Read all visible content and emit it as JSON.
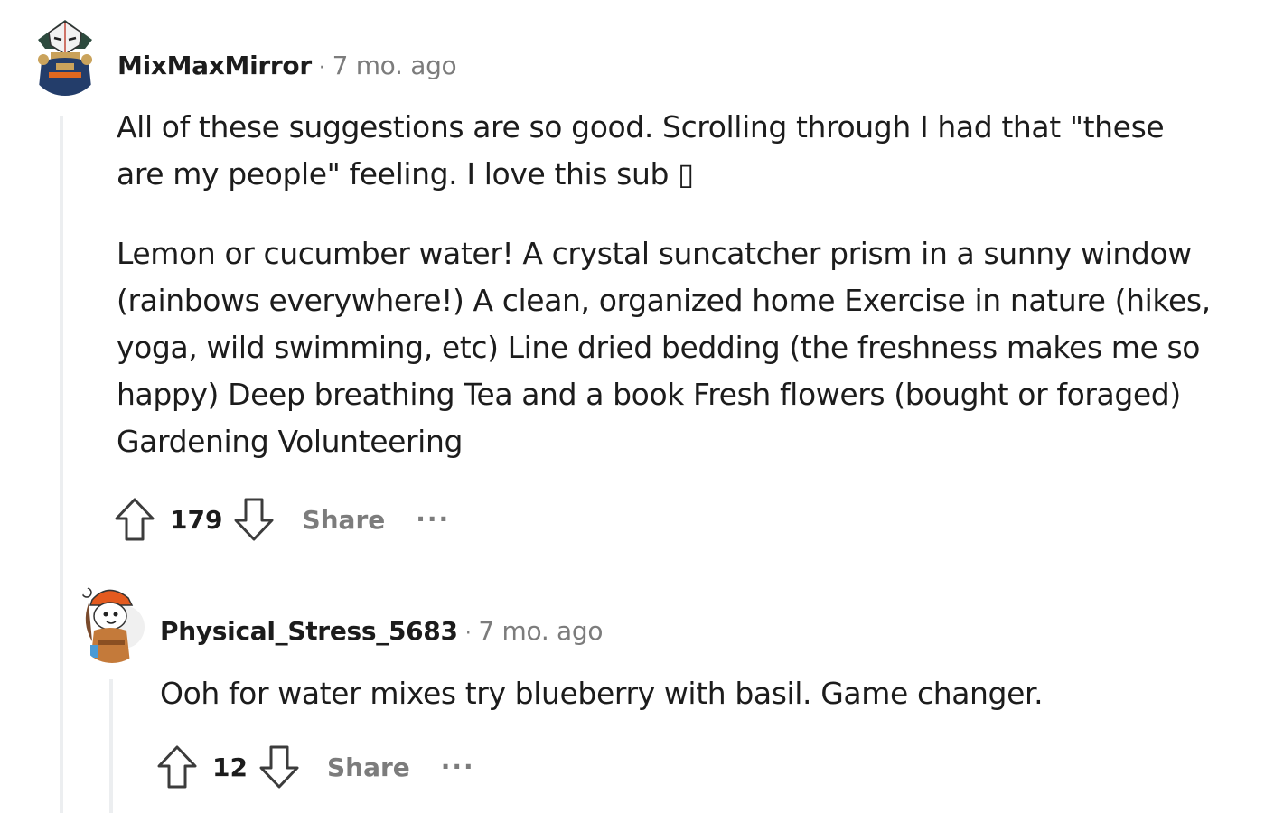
{
  "comments": [
    {
      "username": "MixMaxMirror",
      "separator": "·",
      "time": "7 mo. ago",
      "paragraphs": [
        "All of these suggestions are so good. Scrolling through I had that \"these are my people\" feeling. I love this sub ▯",
        "Lemon or cucumber water! A crystal suncatcher prism in a sunny window (rainbows everywhere!) A clean, organized home Exercise in nature (hikes, yoga, wild swimming, etc) Line dried bedding (the freshness makes me so happy) Deep breathing Tea and a book Fresh flowers (bought or foraged) Gardening Volunteering"
      ],
      "score": "179",
      "share_label": "Share",
      "more_label": "..."
    },
    {
      "username": "Physical_Stress_5683",
      "separator": "·",
      "time": "7 mo. ago",
      "paragraphs": [
        "Ooh for water mixes try blueberry with basil. Game changer."
      ],
      "score": "12",
      "share_label": "Share",
      "more_label": "..."
    }
  ],
  "colors": {
    "text": "#1c1c1c",
    "meta": "#7c7c7c",
    "thread_line": "#eceef0"
  }
}
